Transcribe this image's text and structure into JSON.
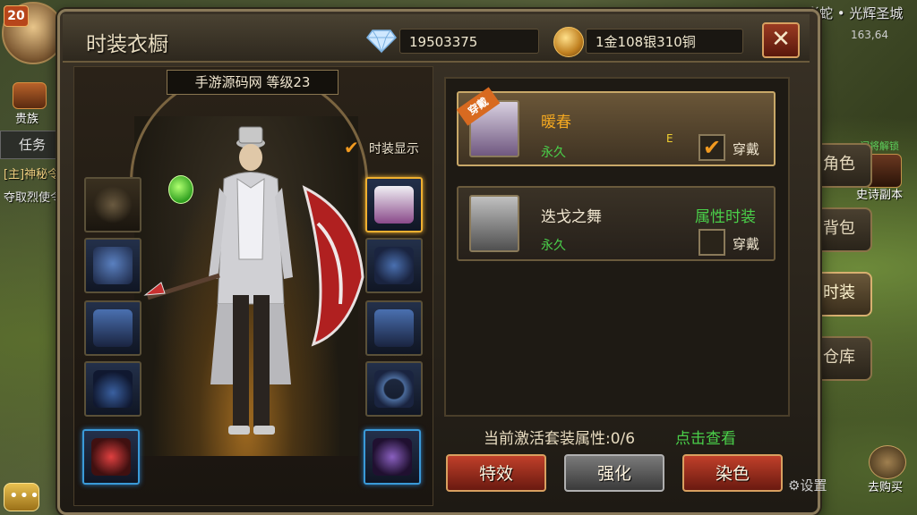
{
  "hud": {
    "level": "20",
    "guild_label": "贵族",
    "task_tab": "任务",
    "task_line1": "[主]神秘令",
    "task_line2": "夺取烈使令",
    "map_name": "彩蛇 • 光辉圣城",
    "coords": "163,64",
    "chat_dots": "•••",
    "side_buttons": [
      "角色",
      "背包",
      "时装",
      "仓库"
    ],
    "epic_unlock": "闪将解锁",
    "epic_label": "史诗副本",
    "settings_label": "设置",
    "buy_label": "去购买"
  },
  "window": {
    "title": "时装衣橱",
    "diamonds": "19503375",
    "money": "1金108银310铜",
    "close_icon": "close-icon"
  },
  "character": {
    "name_level": "手游源码网  等级23",
    "show_fashion_label": "时装显示",
    "show_fashion_checked": true
  },
  "items": [
    {
      "name": "暖春",
      "duration": "永久",
      "tag": "E",
      "wear_label": "穿戴",
      "worn": true,
      "ribbon": "穿戴"
    },
    {
      "name": "迭戈之舞",
      "duration": "永久",
      "tag": "属性时装",
      "wear_label": "穿戴",
      "worn": false
    }
  ],
  "set_bonus": {
    "text": "当前激活套装属性:0/6",
    "link": "点击查看"
  },
  "buttons": {
    "effect": "特效",
    "enhance": "强化",
    "dye": "染色"
  },
  "colors": {
    "accent_gold": "#f4a820",
    "green_text": "#4ad04a",
    "button_red": "#c0402a"
  }
}
